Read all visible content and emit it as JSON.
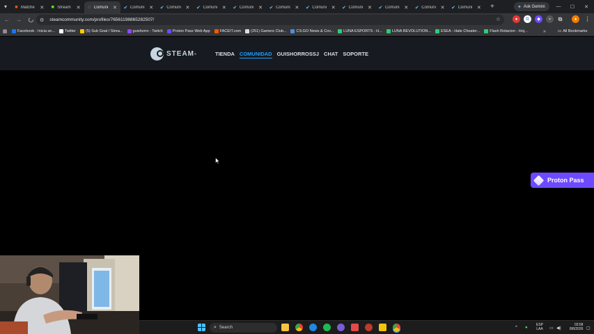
{
  "browser": {
    "tabs": [
      {
        "title": "Matche",
        "favicon": "faceit-icon",
        "color": "#ff5500"
      },
      {
        "title": "Stream",
        "favicon": "kick-icon",
        "color": "#53fc18"
      },
      {
        "title": "Comuni",
        "favicon": "loading-icon",
        "color": "#c4c7c5",
        "active": true
      },
      {
        "title": "Comuni",
        "favicon": "steam-check-icon",
        "color": "#66c0f4"
      },
      {
        "title": "Comuni",
        "favicon": "steam-check-icon",
        "color": "#66c0f4"
      },
      {
        "title": "Comuni",
        "favicon": "steam-check-icon",
        "color": "#66c0f4"
      },
      {
        "title": "Comuni",
        "favicon": "steam-check-icon",
        "color": "#66c0f4"
      },
      {
        "title": "Comuni",
        "favicon": "steam-check-icon",
        "color": "#66c0f4"
      },
      {
        "title": "Comuni",
        "favicon": "steam-check-icon",
        "color": "#66c0f4"
      },
      {
        "title": "Comuni",
        "favicon": "steam-check-icon",
        "color": "#66c0f4"
      },
      {
        "title": "Comuni",
        "favicon": "steam-check-icon",
        "color": "#66c0f4"
      },
      {
        "title": "Comuni",
        "favicon": "steam-check-icon",
        "color": "#66c0f4"
      },
      {
        "title": "Comuni",
        "favicon": "steam-check-icon",
        "color": "#66c0f4"
      }
    ],
    "gemini_label": "Ask Gemini",
    "url": "steamcommunity.com/profiles/76561198865282507/",
    "bookmarks": [
      {
        "label": "Facebook - Inicia se...",
        "color": "#1877f2"
      },
      {
        "label": "Twitter",
        "color": "#ffffff"
      },
      {
        "label": "(5) Sub Goal / Strea...",
        "color": "#ffcc00"
      },
      {
        "label": "guishorro - Twitch",
        "color": "#9146ff"
      },
      {
        "label": "Proton Pass Web App",
        "color": "#6d4aff"
      },
      {
        "label": "FACEIT.com",
        "color": "#ff5500"
      },
      {
        "label": "(251) Gamers Club...",
        "color": "#dddddd"
      },
      {
        "label": "CS:GO News & Cov...",
        "color": "#4f8fd6"
      },
      {
        "label": "LUNA ESPORTS - H...",
        "color": "#2ecc71"
      },
      {
        "label": "LUNA REVOLUTION...",
        "color": "#2ecc71"
      },
      {
        "label": "ESEA - Hate Cheater...",
        "color": "#2ecc71"
      },
      {
        "label": "Flash Rotacion - Hoj...",
        "color": "#2ecc71"
      }
    ],
    "bookmarks_more": "»",
    "all_bookmarks": "All Bookmarks"
  },
  "steam": {
    "logo_text": "STEAM",
    "logo_tm": "®",
    "nav": [
      {
        "label": "TIENDA",
        "active": false
      },
      {
        "label": "COMUNIDAD",
        "active": true
      },
      {
        "label": "GUISHORROSSJ",
        "active": false
      },
      {
        "label": "CHAT",
        "active": false
      },
      {
        "label": "SOPORTE",
        "active": false
      }
    ]
  },
  "proton_pass": {
    "label": "Proton Pass"
  },
  "taskbar": {
    "search_label": "Search",
    "language": "ESP",
    "layout": "LAA",
    "time": "03:58",
    "date": "8/8/2026"
  }
}
